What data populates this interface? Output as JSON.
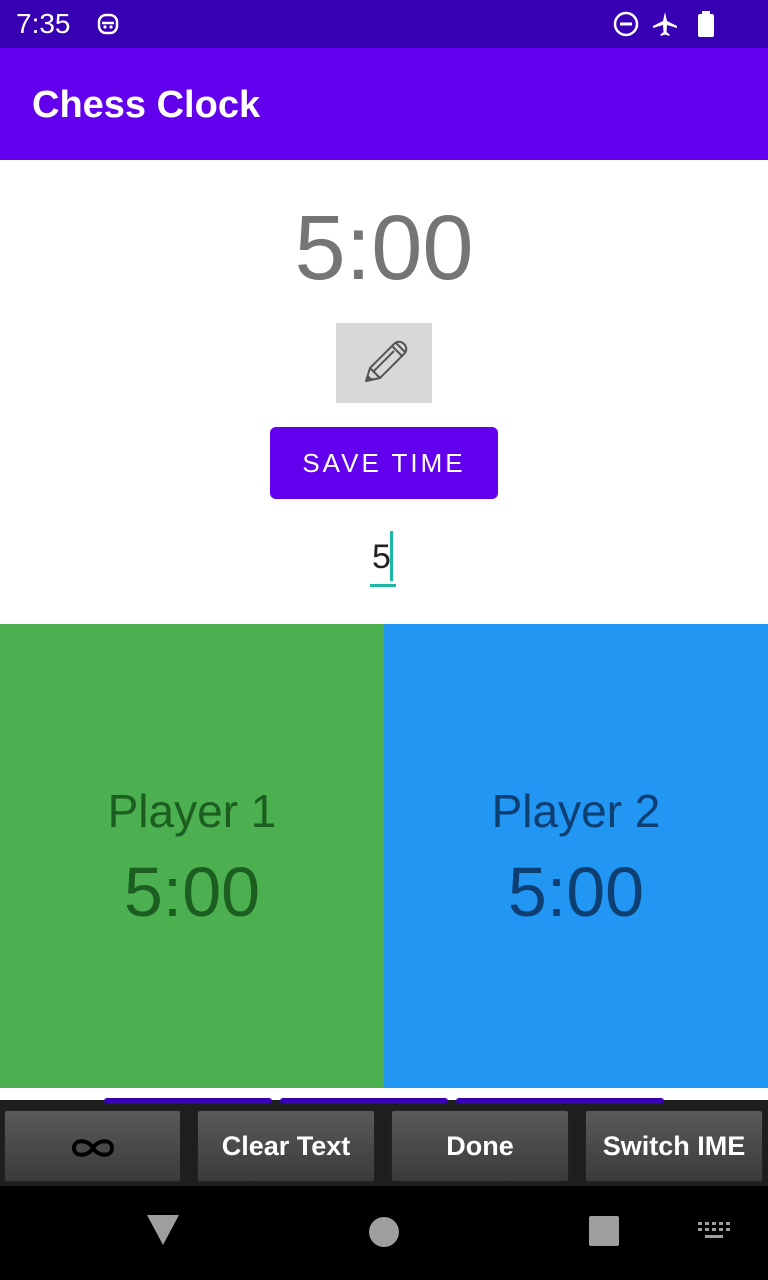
{
  "status_bar": {
    "time": "7:35",
    "icons": [
      "robot-icon",
      "do-not-disturb-icon",
      "airplane-icon",
      "battery-icon"
    ],
    "background": "#3700b3"
  },
  "app_bar": {
    "title": "Chess Clock",
    "background": "#6200ee"
  },
  "main": {
    "time_display": "5:00",
    "edit_icon": "pencil-icon",
    "save_button_label": "SAVE TIME",
    "time_input_value": "5"
  },
  "players": [
    {
      "label": "Player 1",
      "time": "5:00",
      "color": "#4caf50",
      "text_color": "#1b5e20"
    },
    {
      "label": "Player 2",
      "time": "5:00",
      "color": "#2196f3",
      "text_color": "#0d3f73"
    }
  ],
  "ime_bar": {
    "infinity_icon": "infinity-icon",
    "clear_text": "Clear Text",
    "done": "Done",
    "switch_ime": "Switch IME"
  },
  "nav_bar": {
    "icons": [
      "back-icon",
      "home-icon",
      "recents-icon",
      "keyboard-icon"
    ]
  }
}
